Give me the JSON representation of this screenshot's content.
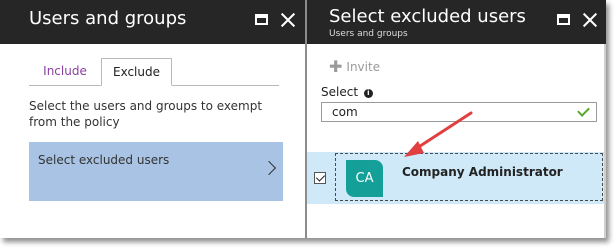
{
  "left_blade": {
    "title": "Users and groups",
    "tabs": [
      {
        "label": "Include",
        "active": false
      },
      {
        "label": "Exclude",
        "active": true
      }
    ],
    "description": "Select the users and groups to exempt from the policy",
    "select_excluded_label": "Select excluded users"
  },
  "right_blade": {
    "title": "Select excluded users",
    "subtitle": "Users and groups",
    "invite_label": "Invite",
    "select_label": "Select",
    "search_value": "com",
    "results": [
      {
        "initials": "CA",
        "name": "Company Administrator",
        "checked": true
      }
    ]
  },
  "icons": {
    "maximize": "maximize-icon",
    "close": "close-icon",
    "plus": "plus-icon",
    "info": "info-icon",
    "chevron": "chevron-right-icon",
    "check": "checkmark-icon",
    "annotation_arrow": "arrow-annotation-icon"
  },
  "colors": {
    "header_bg": "#262626",
    "tab_include_text": "#8a3fa0",
    "select_tile_bg": "#a8c3e3",
    "result_row_bg": "#cfe9f8",
    "avatar_bg": "#14a098",
    "valid_check": "#5aa82e",
    "annotation_arrow": "#e04040"
  }
}
